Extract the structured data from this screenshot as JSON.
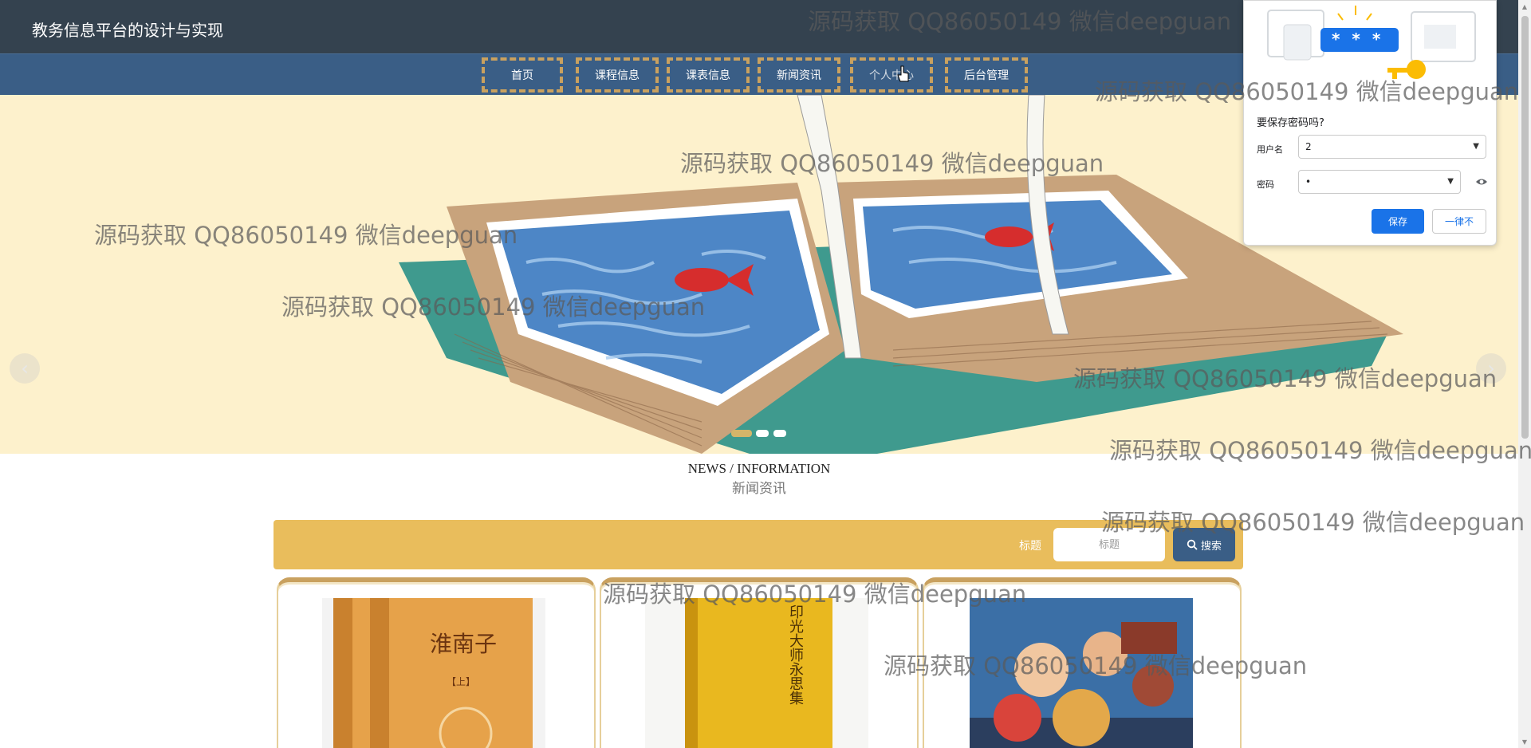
{
  "header": {
    "site_title": "教务信息平台的设计与实现"
  },
  "nav": {
    "items": [
      "首页",
      "课程信息",
      "课表信息",
      "新闻资讯",
      "个人中心",
      "后台管理"
    ]
  },
  "carousel": {
    "prev_icon": "‹",
    "next_icon": "›",
    "slide_count": 3,
    "active_slide": 1
  },
  "section": {
    "en_title": "NEWS / INFORMATION",
    "cn_title": "新闻资讯"
  },
  "search": {
    "label": "标题",
    "placeholder": "标题",
    "button_label": "搜索"
  },
  "cards": [
    {
      "cover_title": "淮南子",
      "cover_sub": "【上】"
    },
    {
      "cover_title": "印光大师永思集"
    },
    {
      "cover_title": ""
    }
  ],
  "password_popup": {
    "title": "要保存密码吗?",
    "username_label": "用户名",
    "username_value": "2",
    "password_label": "密码",
    "password_value": "•",
    "save_button": "保存",
    "never_button": "一律不",
    "art_text": "* * *"
  },
  "watermark": "源码获取 QQ86050149 微信deepguan"
}
